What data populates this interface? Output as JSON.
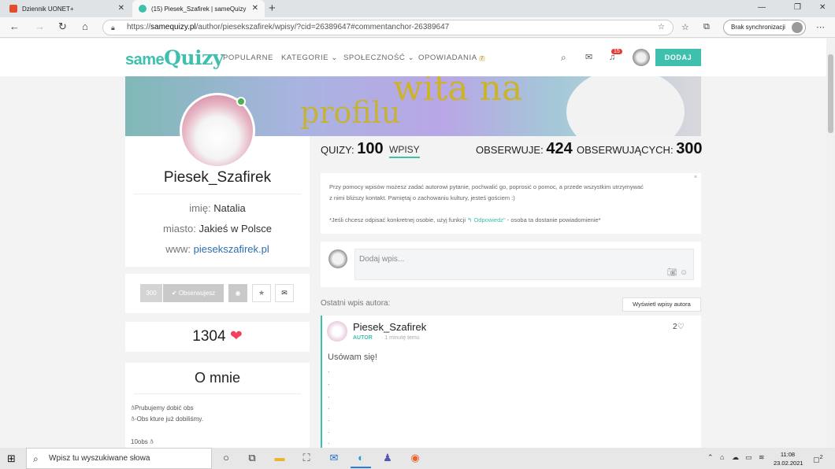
{
  "browser": {
    "tabs": [
      {
        "label": "Dziennik UONET+",
        "close": "✕"
      },
      {
        "label": "(15) Piesek_Szafirek | sameQuizy",
        "close": "✕"
      }
    ],
    "new_tab": "+",
    "url_prefix": "https://",
    "url_domain": "samequizy.pl",
    "url_rest": "/author/piesekszafirek/wpisy/?cid=26389647#commentanchor-26389647",
    "sync_label": "Brak synchronizacji",
    "window_controls": [
      "—",
      "❐",
      "✕"
    ]
  },
  "site": {
    "logo_same": "same",
    "logo_quizy": "Quizy",
    "nav": [
      "POPULARNE",
      "KATEGORIE",
      "SPOŁECZNOŚĆ",
      "OPOWIADANIA"
    ],
    "opowiadania_badge": "7",
    "notifications": "15",
    "add_button": "DODAJ"
  },
  "banner": {
    "line1": "wita na",
    "line2": "profilu"
  },
  "profile": {
    "username": "Piesek_Szafirek",
    "name_label": "imię:",
    "name_value": "Natalia",
    "city_label": "miasto:",
    "city_value": "Jakieś w Polsce",
    "www_label": "www:",
    "www_value": "piesekszafirek.pl",
    "observe_count": "300",
    "observe_label": "✔ Obserwujesz",
    "likes": "1304",
    "about_title": "O mnie",
    "about_lines": [
      "Prubujemy dobić obs",
      "-Obs kture już dobiliśmy.",
      "10obs"
    ]
  },
  "stats": {
    "quizy_label": "QUIZY:",
    "quizy_value": "100",
    "wpisy_label": "WPISY",
    "obserwuje_label": "OBSERWUJE:",
    "obserwuje_value": "424",
    "obserwujacych_label": "OBSERWUJĄCYCH:",
    "obserwujacych_value": "300"
  },
  "infobox": {
    "line1": "Przy pomocy wpisów możesz zadać autorowi pytanie, pochwalić go, poprosić o pomoc, a przede wszystkim utrzymywać",
    "line2": "z nimi bliższy kontakt. Pamiętaj o zachowaniu kultury, jesteś gościem :)",
    "line3_a": "*Jeśli chcesz odpisać konkretnej osobie, użyj funkcji",
    "line3_link": "↰ Odpowiedz\"",
    "line3_b": " - osoba ta dostanie powiadomienie*",
    "close": "×"
  },
  "compose": {
    "placeholder": "Dodaj wpis..."
  },
  "posts": {
    "section_label": "Ostatni wpis autora:",
    "show_button": "Wyświetl wpisy autora",
    "author": "Piesek_Szafirek",
    "badge": "AUTOR",
    "time": "· 1 minutę temu",
    "likes": "2",
    "text": "Usówam się!",
    "dots": [
      ".",
      ".",
      ".",
      ".",
      ".",
      ".",
      "."
    ]
  },
  "taskbar": {
    "search_placeholder": "Wpisz tu wyszukiwane słowa",
    "time": "11:08",
    "date": "23.02.2021",
    "notification_count": "2"
  }
}
